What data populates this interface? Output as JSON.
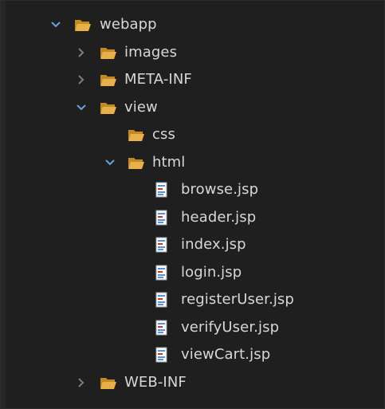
{
  "tree": {
    "nodes": [
      {
        "label": "webapp",
        "type": "folder",
        "state": "expanded",
        "icon": "folder-open-icon"
      },
      {
        "label": "images",
        "type": "folder",
        "state": "collapsed",
        "icon": "folder-open-icon"
      },
      {
        "label": "META-INF",
        "type": "folder",
        "state": "collapsed",
        "icon": "folder-open-icon"
      },
      {
        "label": "view",
        "type": "folder",
        "state": "expanded",
        "icon": "folder-open-icon"
      },
      {
        "label": "css",
        "type": "folder",
        "state": "leaf",
        "icon": "folder-open-icon"
      },
      {
        "label": "html",
        "type": "folder",
        "state": "expanded",
        "icon": "folder-open-icon"
      },
      {
        "label": "browse.jsp",
        "type": "file",
        "icon": "jsp-file-icon"
      },
      {
        "label": "header.jsp",
        "type": "file",
        "icon": "jsp-file-icon"
      },
      {
        "label": "index.jsp",
        "type": "file",
        "icon": "jsp-file-icon"
      },
      {
        "label": "login.jsp",
        "type": "file",
        "icon": "jsp-file-icon"
      },
      {
        "label": "registerUser.jsp",
        "type": "file",
        "icon": "jsp-file-icon"
      },
      {
        "label": "verifyUser.jsp",
        "type": "file",
        "icon": "jsp-file-icon"
      },
      {
        "label": "viewCart.jsp",
        "type": "file",
        "icon": "jsp-file-icon"
      },
      {
        "label": "WEB-INF",
        "type": "folder",
        "state": "collapsed",
        "icon": "folder-open-icon"
      }
    ]
  },
  "colors": {
    "background": "#1f1f1f",
    "text": "#d7d7d7",
    "folder": "#e8b04a",
    "folder_dark": "#c48a22",
    "twisty_expanded": "#6aa2de",
    "twisty_collapsed": "#7d7d7d",
    "file_page": "#ffffff",
    "file_lines": "#5b8fd6",
    "file_mark": "#c0392b"
  }
}
